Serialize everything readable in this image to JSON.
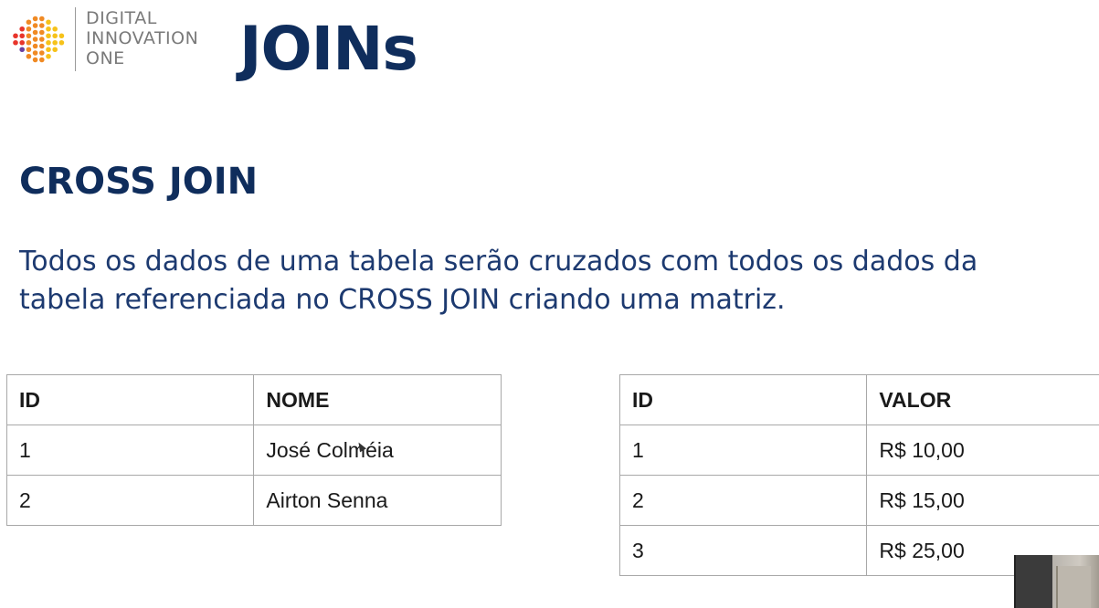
{
  "brand": {
    "lines": [
      "DIGITAL",
      "INNOVATION",
      "ONE"
    ],
    "accent_colors": [
      "#e8352b",
      "#f08a24",
      "#f6c21a",
      "#6a3fa0"
    ]
  },
  "title": "JOINs",
  "section": {
    "heading": "CROSS JOIN",
    "description_lines": [
      "Todos os dados de uma tabela serão cruzados com todos os dados da",
      "tabela referenciada no CROSS JOIN criando uma matriz."
    ]
  },
  "tables": [
    {
      "headers": [
        "ID",
        "NOME"
      ],
      "rows": [
        [
          "1",
          "José Colméia"
        ],
        [
          "2",
          "Airton Senna"
        ]
      ]
    },
    {
      "headers": [
        "ID",
        "VALOR"
      ],
      "rows": [
        [
          "1",
          "R$ 10,00"
        ],
        [
          "2",
          "R$ 15,00"
        ],
        [
          "3",
          "R$ 25,00"
        ]
      ]
    }
  ],
  "colors": {
    "title": "#0f2d5c",
    "body_text": "#1d3a70",
    "table_border": "#a8a8a8"
  }
}
